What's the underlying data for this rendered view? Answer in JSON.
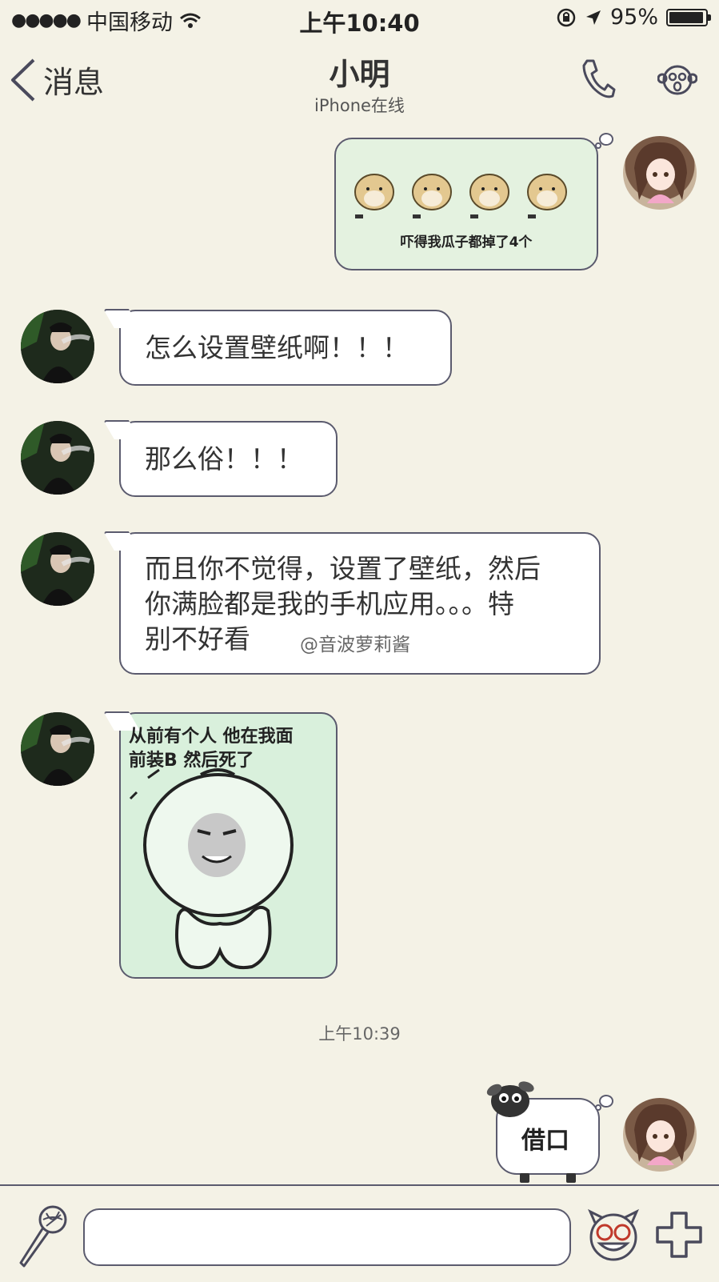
{
  "status_bar": {
    "signal_dots": "●●●●●",
    "carrier": "中国移动",
    "time": "上午10:40",
    "battery_percent": "95%",
    "battery_level": 0.95
  },
  "nav": {
    "back_label": "消息",
    "title": "小明",
    "subtitle": "iPhone在线"
  },
  "messages": [
    {
      "sender": "me",
      "type": "sticker",
      "sticker_caption": "吓得我瓜子都掉了4个"
    },
    {
      "sender": "other",
      "type": "text",
      "text": "怎么设置壁纸啊！！！"
    },
    {
      "sender": "other",
      "type": "text",
      "text": "那么俗！！！"
    },
    {
      "sender": "other",
      "type": "text",
      "lines": [
        "而且你不觉得，设置了壁纸，然后",
        "你满脸都是我的手机应用。。。特",
        "别不好看"
      ]
    },
    {
      "sender": "other",
      "type": "sticker",
      "sticker_lines": [
        "从前有个人 他在我面",
        "前装B  然后死了"
      ]
    },
    {
      "sender": "me",
      "type": "sticker",
      "sticker_caption": "借口"
    }
  ],
  "timestamp": "上午10:39",
  "watermark": "@音波萝莉酱",
  "icons": {
    "back": "chevron-left-icon",
    "call": "phone-icon",
    "profile": "monkey-face-icon",
    "voice": "microphone-icon",
    "emoji": "emoji-face-icon",
    "more": "plus-icon"
  }
}
